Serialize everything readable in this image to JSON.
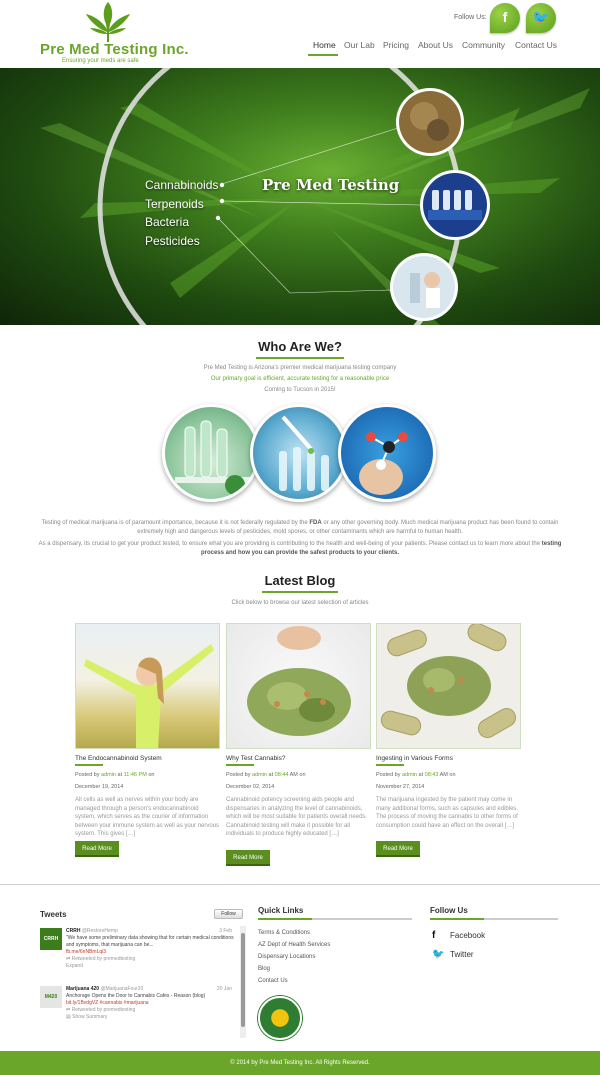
{
  "brand": {
    "name": "Pre Med Testing Inc.",
    "tagline": "Ensuring your meds are safe",
    "accent": "#6aa62a"
  },
  "social": {
    "follow_label": "Follow Us:",
    "facebook_glyph": "f",
    "twitter_glyph": "🐦"
  },
  "nav": {
    "items": [
      "Home",
      "Our Lab",
      "Pricing",
      "About Us",
      "Community",
      "Contact Us"
    ],
    "active": "Home"
  },
  "hero": {
    "list": [
      "Cannabinoids",
      "Terpenoids",
      "Bacteria",
      "Pesticides"
    ],
    "title": "Pre Med Testing"
  },
  "who": {
    "title": "Who Are We?",
    "line1": "Pre Med Testing is Arizona's premier medical marijuana testing company",
    "line2": "Our primary goal is efficient, accurate testing for a reasonable price",
    "line3": "Coming to Tucson in 2015!",
    "para1_a": "Testing of medical marijuana is of paramount importance, because it is not federally regulated by the ",
    "para1_fda": "FDA",
    "para1_b": " or any other governing body. Much medical marijuana product has been found to contain extremely high and dangerous levels of pesticides, mold spores, or other contaminants which are harmful to human health.",
    "para2_a": "As a dispensary, its crucial to get your product tested, to ensure what you are providing is contributing to the health and well-being of your patients. Please contact us to learn more about the ",
    "para2_b": "testing process and how you can provide the safest products to your clients."
  },
  "blog": {
    "title": "Latest Blog",
    "subtitle": "Click below to browse our latest selection of articles",
    "posts": [
      {
        "title": "The Endocannabinoid System",
        "posted_by": "Posted by",
        "author": "admin",
        "at": "at",
        "time": "11:46 PM",
        "on": "on",
        "date": "December 19, 2014",
        "excerpt": "All cells as well as nerves within your body are managed through a person's endocannabinoid system, which serves as the courier of information between your immune system as well as your nervous system. This gives […]",
        "button": "Read More"
      },
      {
        "title": "Why Test Cannabis?",
        "posted_by": "Posted by",
        "author": "admin",
        "at": "at",
        "time": "08:44",
        "on": "AM on",
        "date": "December 02, 2014",
        "excerpt": "Cannabinoid potency screening aids people and dispensaries in analyzing the level of cannabinoids, which will be most suitable for patients overall needs. Cannabinoid testing will make it possible for all individuals to produce highly educated […]",
        "button": "Read More"
      },
      {
        "title": "Ingesting in Various Forms",
        "posted_by": "Posted by",
        "author": "admin",
        "at": "at",
        "time": "08:43",
        "on": "AM on",
        "date": "November 27, 2014",
        "excerpt": "The marijuana ingested by the patient may come in many additional forms, such as capsules and edibles.  The process of moving the cannabis to other forms of consumption could have an effect on the overall […]",
        "button": "Read More"
      }
    ]
  },
  "footer": {
    "tweets_title": "Tweets",
    "follow_btn": "Follow",
    "tweets": [
      {
        "avatar": "CRRH",
        "name": "CRRH",
        "handle": "@RestoreHemp",
        "date": "3 Feb",
        "text": "\"We have some preliminary data showing that for certain medical conditions and symptoms, that marijuana can be...",
        "link": "fb.me/6nNBmLqi3",
        "retweet": "Retweeted by premedtesting",
        "action": "Expand"
      },
      {
        "avatar": "M420",
        "name": "Marijuana 420",
        "handle": "@MarijuanaFour20",
        "date": "20 Jan",
        "text": "Anchorage Opens the Door to Cannabis Cafes - Reason (blog)",
        "link": "bit.ly/1BvdgVZ #cannabis #marijuana",
        "retweet": "Retweeted by premedtesting",
        "action": "Show Summary"
      }
    ],
    "quick_links_title": "Quick Links",
    "quick_links": [
      "Terms & Conditions",
      "AZ Dept of Health Services",
      "Dispensary Locations",
      "Blog",
      "Contact Us"
    ],
    "follow_title": "Follow Us",
    "follow_links": [
      {
        "icon": "f",
        "label": "Facebook"
      },
      {
        "icon": "🐦",
        "label": "Twitter"
      }
    ],
    "copyright": "© 2014 by Pre Med Testing Inc. All Rights Reserved."
  }
}
